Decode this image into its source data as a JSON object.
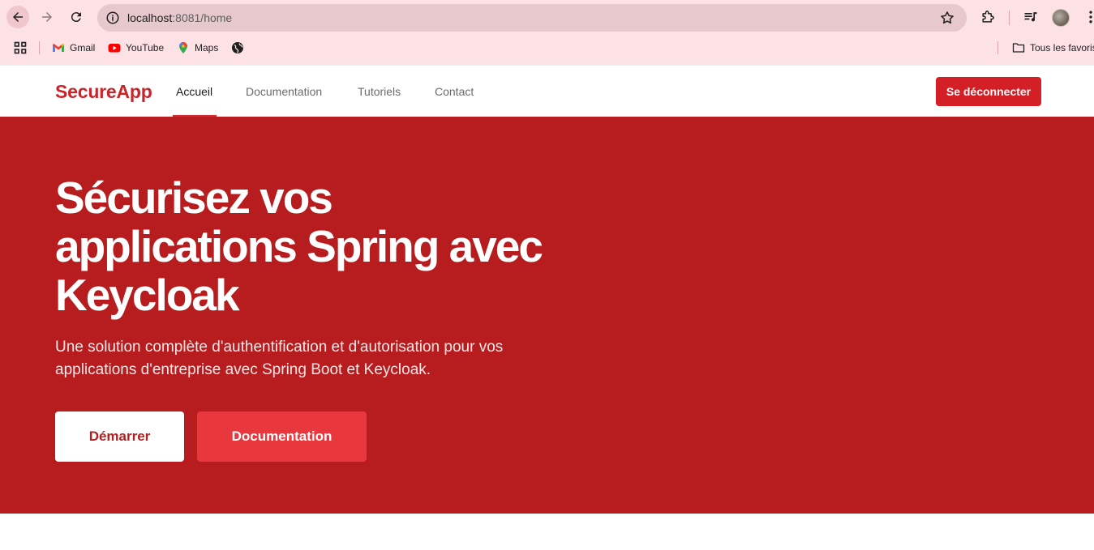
{
  "browser": {
    "url_host": "localhost",
    "url_path": ":8081/home",
    "bookmarks": [
      {
        "label": "Gmail",
        "icon": "gmail-icon"
      },
      {
        "label": "YouTube",
        "icon": "youtube-icon"
      },
      {
        "label": "Maps",
        "icon": "maps-icon"
      },
      {
        "label": "",
        "icon": "globe-icon"
      }
    ],
    "all_bookmarks_label": "Tous les favoris"
  },
  "site": {
    "brand": "SecureApp",
    "nav": {
      "home": "Accueil",
      "docs": "Documentation",
      "tutorials": "Tutoriels",
      "contact": "Contact"
    },
    "logout_label": "Se déconnecter",
    "colors": {
      "brand_red": "#c8242a",
      "hero_bg": "#b71c1e",
      "secondary_btn": "#e8383e"
    }
  },
  "hero": {
    "title": "Sécurisez vos applications Spring avec Keycloak",
    "subtitle": "Une solution complète d'authentification et d'autorisation pour vos applications d'entreprise avec Spring Boot et Keycloak.",
    "primary_cta": "Démarrer",
    "secondary_cta": "Documentation"
  }
}
